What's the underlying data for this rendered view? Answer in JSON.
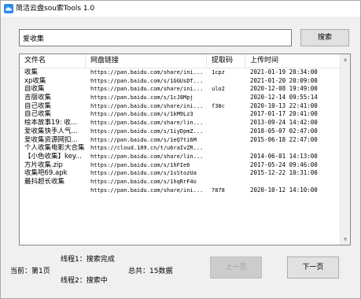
{
  "window": {
    "title": "简洁云盘sou索Tools 1.0"
  },
  "search": {
    "value": "爱收集",
    "button_label": "搜索"
  },
  "table": {
    "headers": {
      "name": "文件名",
      "link": "网盘链接",
      "code": "提取码",
      "time": "上传时间"
    },
    "rows": [
      {
        "name": "收集",
        "link": "https://pan.baidu.com/share/ini...",
        "code": "1cpz",
        "time": "2021-01-19 20:34:00"
      },
      {
        "name": "xp收集",
        "link": "https://pan.baidu.com/s/1GGUsDT...",
        "code": "",
        "time": "2021-01-20 20:09:00"
      },
      {
        "name": "自收集",
        "link": "https://pan.baidu.com/share/ini...",
        "code": "ulo2",
        "time": "2020-12-08 19:49:00"
      },
      {
        "name": "吉丽收集",
        "link": "https://pan.baidu.com/s/1cJ8Mpj",
        "code": "",
        "time": "2020-12-14 09:55:14"
      },
      {
        "name": "自己收集",
        "link": "https://pan.baidu.com/share/ini...",
        "code": "f38c",
        "time": "2020-10-13 22:41:00"
      },
      {
        "name": "自己收集",
        "link": "https://pan.baidu.com/s/1kM9Lz3",
        "code": "",
        "time": "2017-01-17 20:41:00"
      },
      {
        "name": "绘本故事19: 收...",
        "link": "https://pan.baidu.com/share/lin...",
        "code": "",
        "time": "2013-09-24 14:42:00"
      },
      {
        "name": "爱收集快手人气...",
        "link": "https://pan.baidu.com/s/1iyDpmZ...",
        "code": "",
        "time": "2018-05-07 02:47:00"
      },
      {
        "name": "爱收集资源网扣...",
        "link": "https://pan.baidu.com/s/1eQ7ti6M",
        "code": "",
        "time": "2015-06-18 22:47:00"
      },
      {
        "name": "个人收集电影大合集",
        "link": "https://cloud.189.cn/t/u6raIvZR...",
        "code": "",
        "time": ""
      },
      {
        "name": "【小色收集】key...",
        "link": "https://pan.baidu.com/share/lin...",
        "code": "",
        "time": "2014-06-01 14:13:00"
      },
      {
        "name": "方片收集.zip",
        "link": "https://pan.baidu.com/s/1hFIe6",
        "code": "",
        "time": "2017-05-24 09:46:00"
      },
      {
        "name": "收集吧69.apk",
        "link": "https://pan.baidu.com/s/1sStozUa",
        "code": "",
        "time": "2015-12-22 10:31:00"
      },
      {
        "name": "最抖超长收集",
        "link": "https://pan.baidu.com/s/1hqRrF4o",
        "code": "",
        "time": ""
      },
      {
        "name": "",
        "link": "https://pan.baidu.com/share/ini...",
        "code": "7878",
        "time": "2020-10-12 14:10:00"
      }
    ]
  },
  "status": {
    "thread1": "线程1：搜索完成",
    "current_page": "当前：第1页",
    "total": "总共：15数据",
    "thread2": "线程2：搜索中"
  },
  "pager": {
    "prev_label": "上一页",
    "next_label": "下一页"
  }
}
